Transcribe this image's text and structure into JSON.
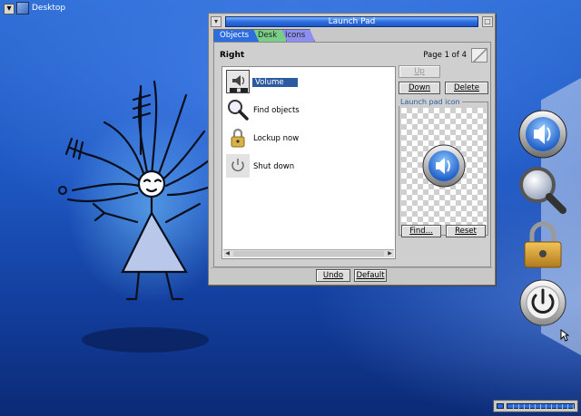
{
  "taskbar": {
    "desktop_label": "Desktop"
  },
  "window": {
    "title": "Launch Pad",
    "tabs": [
      {
        "label": "Objects",
        "color": "#2c6ee0"
      },
      {
        "label": "Desk",
        "color": "#79cf85"
      },
      {
        "label": "Icons",
        "color": "#8d8ff0"
      }
    ],
    "section_title": "Right",
    "page_indicator": "Page 1 of 4",
    "items": [
      {
        "label": "Volume",
        "icon": "speaker-icon",
        "selected": true
      },
      {
        "label": "Find objects",
        "icon": "magnifier-icon",
        "selected": false
      },
      {
        "label": "Lockup now",
        "icon": "padlock-icon",
        "selected": false
      },
      {
        "label": "Shut down",
        "icon": "power-icon",
        "selected": false
      }
    ],
    "buttons": {
      "up": "Up",
      "down": "Down",
      "delete": "Delete",
      "find": "Find...",
      "reset": "Reset",
      "undo": "Undo",
      "default": "Default"
    },
    "icon_group_label": "Launch pad icon"
  },
  "colors": {
    "accent": "#2c6ee0",
    "selection": "#2c5aa0"
  }
}
